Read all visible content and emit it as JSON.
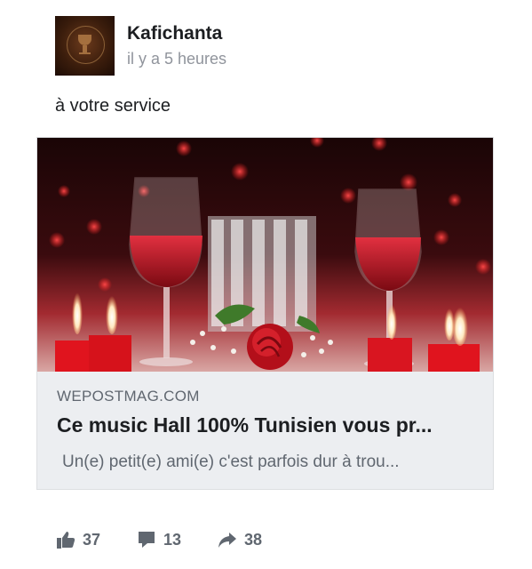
{
  "post": {
    "author": "Kafichanta",
    "timestamp": "il y a 5 heures",
    "text": "à votre service"
  },
  "link": {
    "domain": "WEPOSTMAG.COM",
    "headline": "Ce music Hall 100% Tunisien vous pr...",
    "description": "Un(e) petit(e) ami(e) c'est parfois dur à trou..."
  },
  "actions": {
    "likes": "37",
    "comments": "13",
    "shares": "38"
  },
  "icons": {
    "like": "thumbs-up-icon",
    "comment": "comment-bubble-icon",
    "share": "share-arrow-icon"
  },
  "colors": {
    "muted_text": "#606770",
    "timestamp": "#90949c",
    "card_bg": "#eceef1"
  }
}
